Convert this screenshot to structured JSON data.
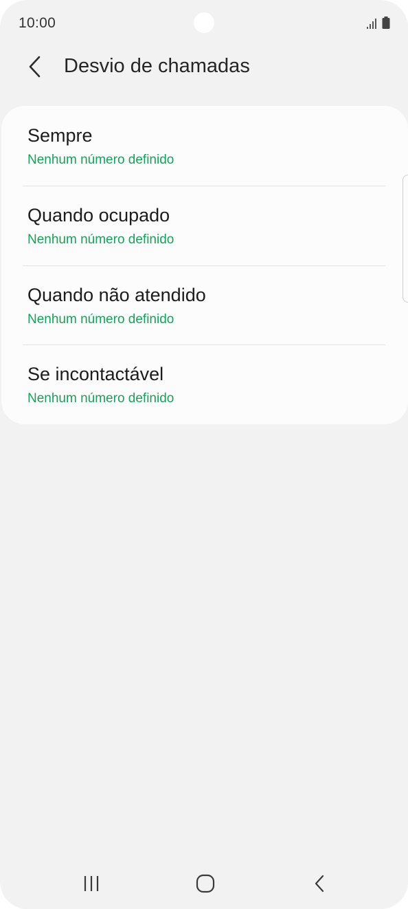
{
  "status_bar": {
    "time": "10:00"
  },
  "header": {
    "back_icon": "chevron-left-icon",
    "title": "Desvio de chamadas"
  },
  "colors": {
    "background": "#f2f2f2",
    "card": "#fcfcfc",
    "accent_green": "#1a9e5b",
    "title_text": "#252525"
  },
  "forwarding_options": [
    {
      "title": "Sempre",
      "subtitle": "Nenhum número definido"
    },
    {
      "title": "Quando ocupado",
      "subtitle": "Nenhum número definido"
    },
    {
      "title": "Quando não atendido",
      "subtitle": "Nenhum número definido"
    },
    {
      "title": "Se incontactável",
      "subtitle": "Nenhum número definido"
    }
  ],
  "nav_bar": {
    "recents_icon": "recent-apps-icon",
    "home_icon": "home-icon",
    "back_icon": "back-icon"
  }
}
